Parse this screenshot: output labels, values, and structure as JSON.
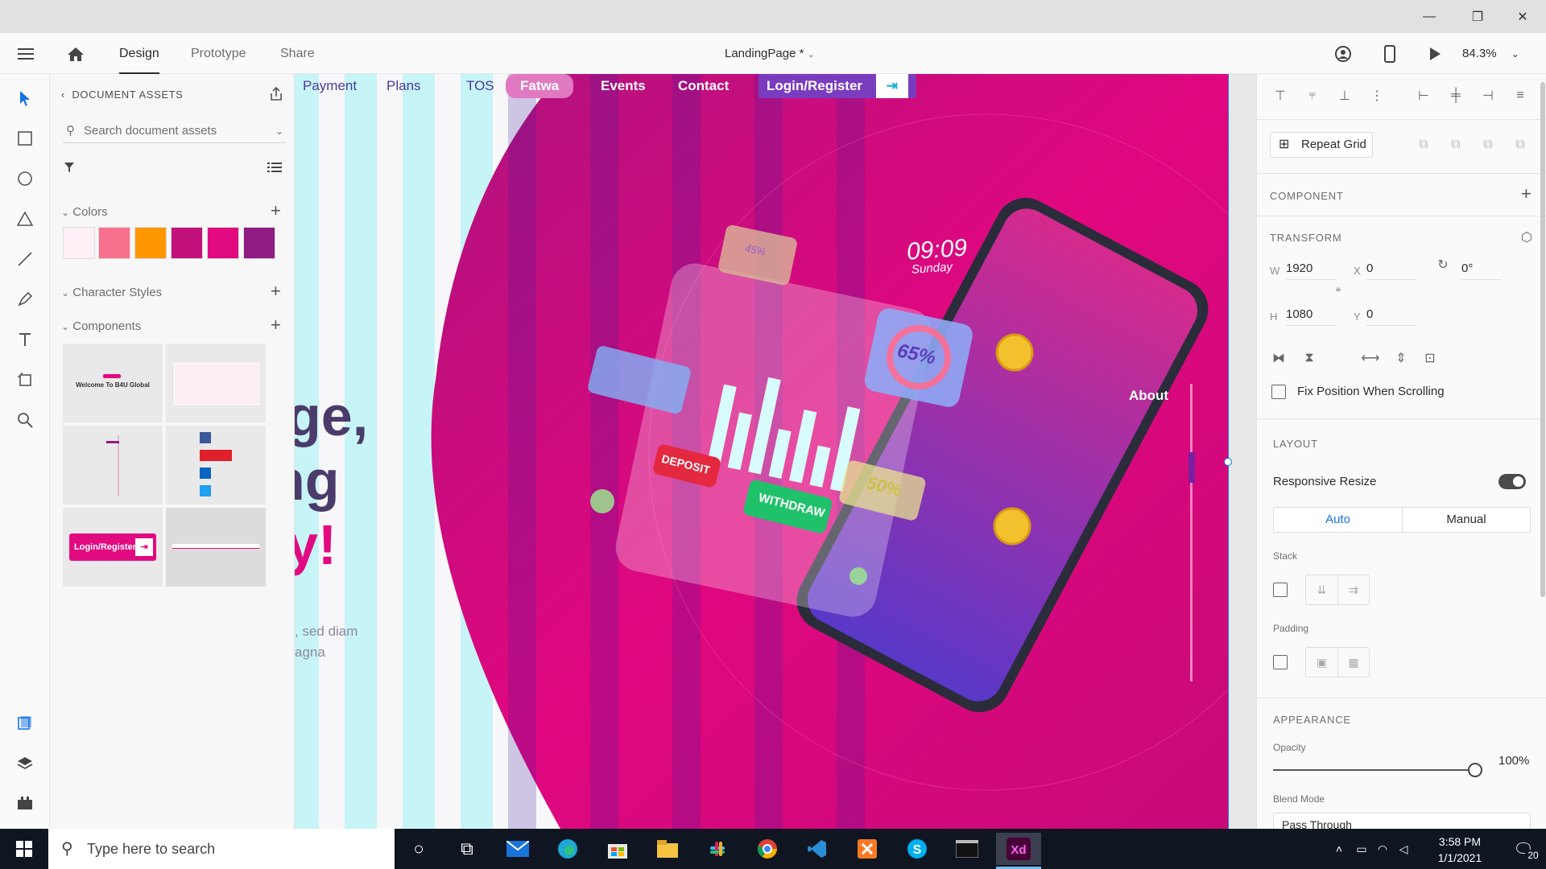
{
  "header": {
    "tabs": [
      "Design",
      "Prototype",
      "Share"
    ],
    "doc_title": "LandingPage *",
    "zoom": "84.3%"
  },
  "assets": {
    "title": "DOCUMENT ASSETS",
    "search_placeholder": "Search document assets",
    "colors_label": "Colors",
    "char_styles_label": "Character Styles",
    "components_label": "Components",
    "swatches": [
      "#fdf0f6",
      "#f7708d",
      "#ff9700",
      "#c3117b",
      "#e20a80",
      "#8f1c83"
    ],
    "component_texts": {
      "welcome": "Welcome To B4U Global",
      "login": "Login/Register"
    }
  },
  "canvas": {
    "nav": [
      "Payment",
      "Plans",
      "TOS",
      "Fatwa",
      "Events",
      "Contact",
      "Login/Register"
    ],
    "hero_lines": [
      "ge,",
      "ng",
      "y!"
    ],
    "hero_sub": [
      ", sed diam",
      "agna"
    ],
    "phone_time": "09:09",
    "phone_day": "Sunday",
    "card_65": "65%",
    "card_45": "45%",
    "card_50": "50%",
    "deposit": "DEPOSIT",
    "withdraw": "WITHDRAW",
    "about": "About"
  },
  "props": {
    "repeat_grid": "Repeat Grid",
    "component": "COMPONENT",
    "transform": "TRANSFORM",
    "w_label": "W",
    "w": "1920",
    "h_label": "H",
    "h": "1080",
    "x_label": "X",
    "x": "0",
    "y_label": "Y",
    "y": "0",
    "rotation": "0°",
    "fix_position": "Fix Position When Scrolling",
    "layout": "LAYOUT",
    "responsive_resize": "Responsive Resize",
    "auto": "Auto",
    "manual": "Manual",
    "stack": "Stack",
    "padding": "Padding",
    "appearance": "APPEARANCE",
    "opacity": "Opacity",
    "opacity_val": "100%",
    "blend_mode": "Blend Mode",
    "blend_value": "Pass Through"
  },
  "taskbar": {
    "search": "Type here to search",
    "time": "3:58 PM",
    "date": "1/1/2021",
    "notif": "20"
  }
}
